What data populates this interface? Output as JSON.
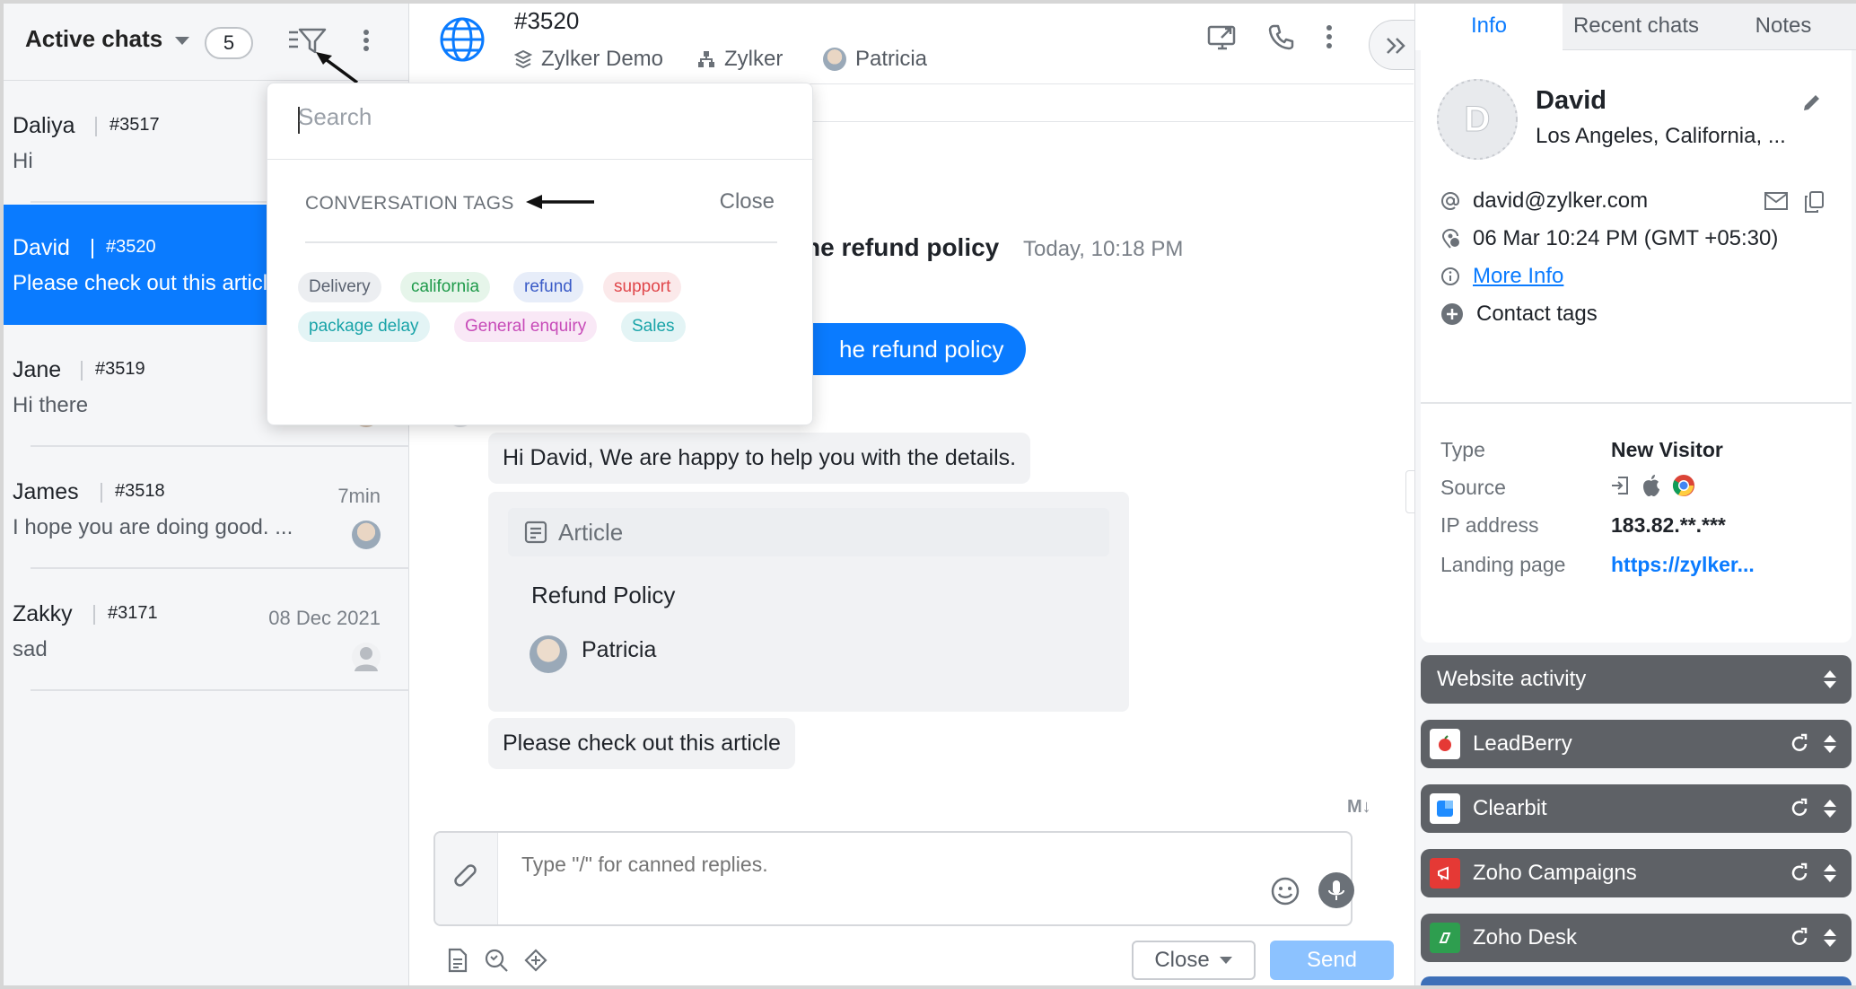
{
  "left": {
    "title": "Active chats",
    "count": "5",
    "chats": [
      {
        "name": "Daliya",
        "id": "#3517",
        "message": "Hi",
        "time": ""
      },
      {
        "name": "David",
        "id": "#3520",
        "message": "Please check out this article",
        "time": ""
      },
      {
        "name": "Jane",
        "id": "#3519",
        "message": "Hi there",
        "time": ""
      },
      {
        "name": "James",
        "id": "#3518",
        "message": "I hope you are doing good. ...",
        "time": "7min"
      },
      {
        "name": "Zakky",
        "id": "#3171",
        "message": "sad",
        "time": "08 Dec 2021"
      }
    ]
  },
  "header": {
    "chat_id": "#3520",
    "portal": "Zylker Demo",
    "department": "Zylker",
    "agent": "Patricia"
  },
  "conversation": {
    "title_fragment": "he refund policy",
    "time": "Today, 10:18 PM",
    "blue_bubble": "he refund policy",
    "reply": "Hi David, We are happy to help you with the details.",
    "article_label": "Article",
    "article_title": "Refund Policy",
    "article_author": "Patricia",
    "last_message": "Please check out this article"
  },
  "composer": {
    "placeholder": "Type \"/\" for canned replies.",
    "close_label": "Close",
    "send_label": "Send",
    "md_label": "M↓"
  },
  "filter_popup": {
    "search_placeholder": "Search",
    "heading": "CONVERSATION TAGS",
    "close_label": "Close",
    "tags": [
      {
        "label": "Delivery",
        "color": "#5a6270",
        "bg": "#eceef1"
      },
      {
        "label": "california",
        "color": "#1e9a4a",
        "bg": "#e6f5ea"
      },
      {
        "label": "refund",
        "color": "#3a5bc7",
        "bg": "#e7edf9"
      },
      {
        "label": "support",
        "color": "#e0464a",
        "bg": "#fbe9ea"
      },
      {
        "label": "package delay",
        "color": "#18a3a8",
        "bg": "#e3f4f5"
      },
      {
        "label": "General enquiry",
        "color": "#c74ab8",
        "bg": "#f9e8f6"
      },
      {
        "label": "Sales",
        "color": "#18a3a8",
        "bg": "#e3f4f5"
      }
    ]
  },
  "right": {
    "tabs": [
      "Info",
      "Recent chats",
      "Notes"
    ],
    "contact": {
      "name": "David",
      "location": "Los Angeles, California, ...",
      "email": "david@zylker.com",
      "datetime": "06 Mar 10:24 PM  (GMT +05:30)",
      "more_info": "More Info",
      "contact_tags": "Contact tags"
    },
    "details": [
      {
        "key": "Type",
        "value": "New Visitor"
      },
      {
        "key": "Source",
        "value": ""
      },
      {
        "key": "IP address",
        "value": "183.82.**.***"
      },
      {
        "key": "Landing page",
        "value": "https://zylker..."
      }
    ],
    "extensions": [
      "Website activity",
      "LeadBerry",
      "Clearbit",
      "Zoho Campaigns",
      "Zoho Desk"
    ]
  },
  "colors": {
    "accent": "#0a7bff",
    "send_disabled": "#8cc2ff",
    "ext_bar": "#5e6166"
  }
}
